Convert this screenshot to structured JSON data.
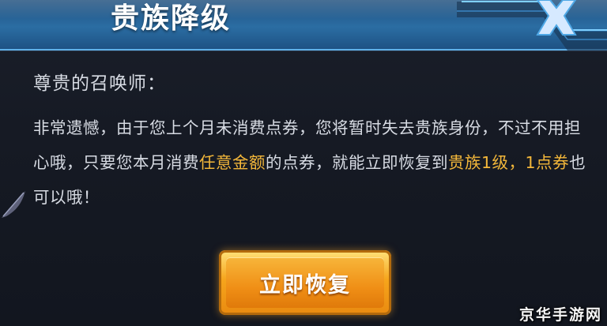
{
  "dialog": {
    "title": "贵族降级",
    "greeting": "尊贵的召唤师：",
    "message": {
      "part1": "非常遗憾，由于您上个月未消费点券，您将暂时失去贵族身份，不过不用担心哦，只要您本月消费",
      "highlight1": "任意金额",
      "part2": "的点券，就能立即恢复到",
      "highlight2": "贵族1级，1点券",
      "part3": "也可以哦！"
    },
    "restore_button": "立即恢复"
  },
  "watermark": "京华手游网",
  "colors": {
    "header": "#2b6da3",
    "highlight": "#f3b73a",
    "button": "#f08f16",
    "text": "#d7dbe3"
  },
  "icons": {
    "close": "close-icon",
    "decoration": "feather-icon"
  }
}
